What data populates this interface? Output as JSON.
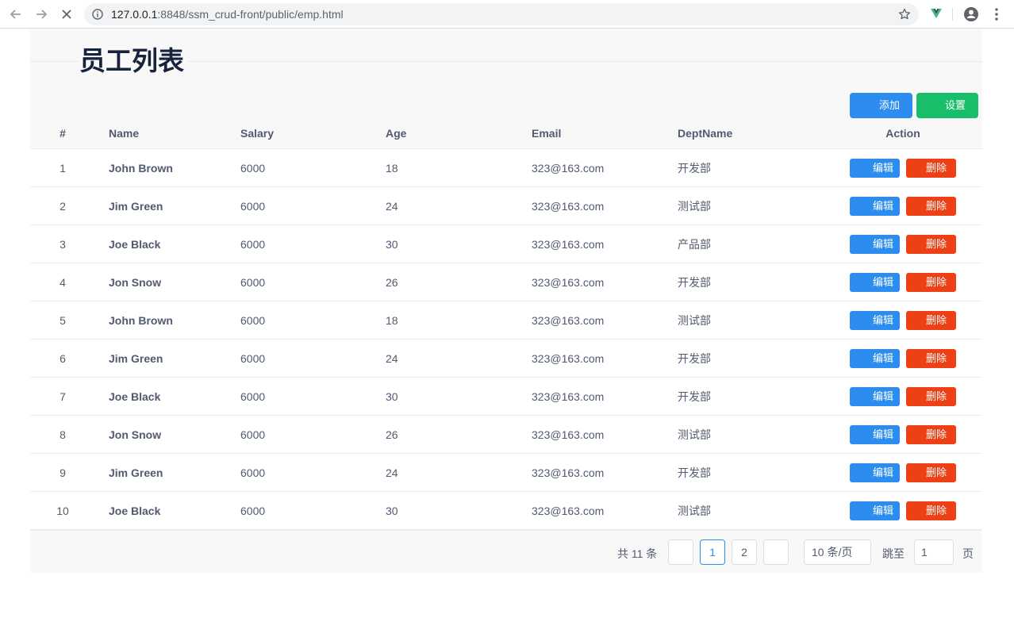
{
  "browser": {
    "url_host": "127.0.0.1",
    "url_rest": ":8848/ssm_crud-front/public/emp.html"
  },
  "page": {
    "title": "员工列表",
    "add_label": "添加",
    "settings_label": "设置"
  },
  "table": {
    "columns": [
      "#",
      "Name",
      "Salary",
      "Age",
      "Email",
      "DeptName",
      "Action"
    ],
    "edit_label": "编辑",
    "delete_label": "删除",
    "rows": [
      {
        "idx": "1",
        "name": "John Brown",
        "salary": "6000",
        "age": "18",
        "email": "323@163.com",
        "dept": "开发部"
      },
      {
        "idx": "2",
        "name": "Jim Green",
        "salary": "6000",
        "age": "24",
        "email": "323@163.com",
        "dept": "测试部"
      },
      {
        "idx": "3",
        "name": "Joe Black",
        "salary": "6000",
        "age": "30",
        "email": "323@163.com",
        "dept": "产品部"
      },
      {
        "idx": "4",
        "name": "Jon Snow",
        "salary": "6000",
        "age": "26",
        "email": "323@163.com",
        "dept": "开发部"
      },
      {
        "idx": "5",
        "name": "John Brown",
        "salary": "6000",
        "age": "18",
        "email": "323@163.com",
        "dept": "测试部"
      },
      {
        "idx": "6",
        "name": "Jim Green",
        "salary": "6000",
        "age": "24",
        "email": "323@163.com",
        "dept": "开发部"
      },
      {
        "idx": "7",
        "name": "Joe Black",
        "salary": "6000",
        "age": "30",
        "email": "323@163.com",
        "dept": "开发部"
      },
      {
        "idx": "8",
        "name": "Jon Snow",
        "salary": "6000",
        "age": "26",
        "email": "323@163.com",
        "dept": "测试部"
      },
      {
        "idx": "9",
        "name": "Jim Green",
        "salary": "6000",
        "age": "24",
        "email": "323@163.com",
        "dept": "开发部"
      },
      {
        "idx": "10",
        "name": "Joe Black",
        "salary": "6000",
        "age": "30",
        "email": "323@163.com",
        "dept": "测试部"
      }
    ]
  },
  "pagination": {
    "total_text": "共 11 条",
    "pages": [
      "1",
      "2"
    ],
    "page_size": "10 条/页",
    "jump_label": "跳至",
    "jump_value": "1",
    "page_suffix": "页"
  },
  "colors": {
    "primary": "#2d8cf0",
    "success": "#19be6b",
    "error": "#ed4014"
  }
}
